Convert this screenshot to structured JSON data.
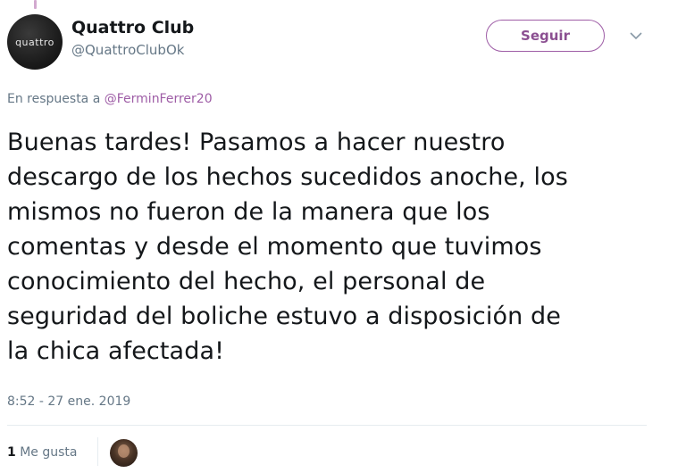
{
  "tweet": {
    "author": {
      "display_name": "Quattro Club",
      "handle": "@QuattroClubOk",
      "avatar_text": "quattro"
    },
    "follow_label": "Seguir",
    "reply_prefix": "En respuesta a",
    "reply_mention": "@FerminFerrer20",
    "text_lines": [
      "Buenas tardes! Pasamos a hacer nuestro",
      "descargo de los hechos sucedidos anoche, los",
      "mismos no fueron de la manera que los",
      "comentas y desde el momento que tuvimos",
      "conocimiento del hecho, el personal de",
      "seguridad del boliche estuvo a disposición de",
      "la chica afectada!"
    ],
    "timestamp": "8:52 - 27 ene. 2019",
    "likes_count": "1",
    "likes_label": "Me gusta"
  },
  "colors": {
    "accent": "#9e5da6",
    "secondary_text": "#657786",
    "primary_text": "#14171a"
  },
  "icons": {
    "more": "chevron-down-icon"
  }
}
